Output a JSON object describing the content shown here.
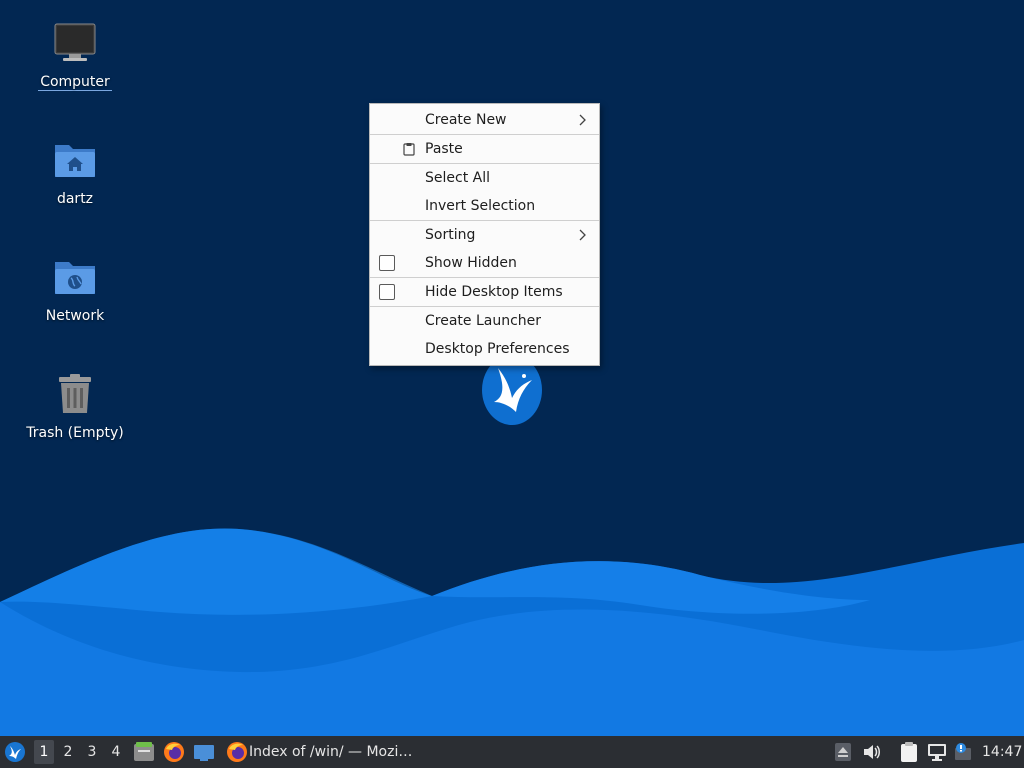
{
  "desktop": {
    "icons": [
      {
        "label": "Computer",
        "icon": "computer-icon"
      },
      {
        "label": "dartz",
        "icon": "home-folder-icon"
      },
      {
        "label": "Network",
        "icon": "network-folder-icon"
      },
      {
        "label": "Trash (Empty)",
        "icon": "trash-icon"
      }
    ]
  },
  "context_menu": {
    "create_new": "Create New",
    "paste": "Paste",
    "select_all": "Select All",
    "invert_selection": "Invert Selection",
    "sorting": "Sorting",
    "show_hidden": "Show Hidden",
    "hide_desktop_items": "Hide Desktop Items",
    "create_launcher": "Create Launcher",
    "desktop_preferences": "Desktop Preferences"
  },
  "taskbar": {
    "workspaces": [
      "1",
      "2",
      "3",
      "4"
    ],
    "active_workspace": "1",
    "task_title": "Index of /win/ — Mozi…",
    "clock": "14:47"
  },
  "colors": {
    "desktop_bg": "#022752",
    "wave_dark": "#0a6fd6",
    "wave_light": "#1e90ff",
    "taskbar_bg": "#2b2e33",
    "folder_blue": "#4a8fd8"
  }
}
